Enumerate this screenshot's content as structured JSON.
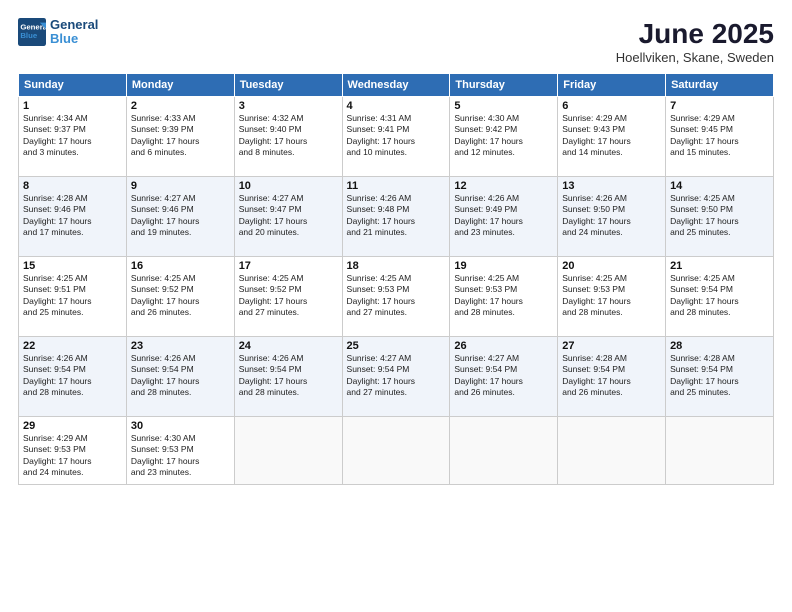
{
  "logo": {
    "line1": "General",
    "line2": "Blue"
  },
  "title": "June 2025",
  "subtitle": "Hoellviken, Skane, Sweden",
  "weekdays": [
    "Sunday",
    "Monday",
    "Tuesday",
    "Wednesday",
    "Thursday",
    "Friday",
    "Saturday"
  ],
  "weeks": [
    [
      {
        "day": 1,
        "sunrise": "4:34 AM",
        "sunset": "9:37 PM",
        "daylight": "17 hours and 3 minutes."
      },
      {
        "day": 2,
        "sunrise": "4:33 AM",
        "sunset": "9:39 PM",
        "daylight": "17 hours and 6 minutes."
      },
      {
        "day": 3,
        "sunrise": "4:32 AM",
        "sunset": "9:40 PM",
        "daylight": "17 hours and 8 minutes."
      },
      {
        "day": 4,
        "sunrise": "4:31 AM",
        "sunset": "9:41 PM",
        "daylight": "17 hours and 10 minutes."
      },
      {
        "day": 5,
        "sunrise": "4:30 AM",
        "sunset": "9:42 PM",
        "daylight": "17 hours and 12 minutes."
      },
      {
        "day": 6,
        "sunrise": "4:29 AM",
        "sunset": "9:43 PM",
        "daylight": "17 hours and 14 minutes."
      },
      {
        "day": 7,
        "sunrise": "4:29 AM",
        "sunset": "9:45 PM",
        "daylight": "17 hours and 15 minutes."
      }
    ],
    [
      {
        "day": 8,
        "sunrise": "4:28 AM",
        "sunset": "9:46 PM",
        "daylight": "17 hours and 17 minutes."
      },
      {
        "day": 9,
        "sunrise": "4:27 AM",
        "sunset": "9:46 PM",
        "daylight": "17 hours and 19 minutes."
      },
      {
        "day": 10,
        "sunrise": "4:27 AM",
        "sunset": "9:47 PM",
        "daylight": "17 hours and 20 minutes."
      },
      {
        "day": 11,
        "sunrise": "4:26 AM",
        "sunset": "9:48 PM",
        "daylight": "17 hours and 21 minutes."
      },
      {
        "day": 12,
        "sunrise": "4:26 AM",
        "sunset": "9:49 PM",
        "daylight": "17 hours and 23 minutes."
      },
      {
        "day": 13,
        "sunrise": "4:26 AM",
        "sunset": "9:50 PM",
        "daylight": "17 hours and 24 minutes."
      },
      {
        "day": 14,
        "sunrise": "4:25 AM",
        "sunset": "9:50 PM",
        "daylight": "17 hours and 25 minutes."
      }
    ],
    [
      {
        "day": 15,
        "sunrise": "4:25 AM",
        "sunset": "9:51 PM",
        "daylight": "17 hours and 25 minutes."
      },
      {
        "day": 16,
        "sunrise": "4:25 AM",
        "sunset": "9:52 PM",
        "daylight": "17 hours and 26 minutes."
      },
      {
        "day": 17,
        "sunrise": "4:25 AM",
        "sunset": "9:52 PM",
        "daylight": "17 hours and 27 minutes."
      },
      {
        "day": 18,
        "sunrise": "4:25 AM",
        "sunset": "9:53 PM",
        "daylight": "17 hours and 27 minutes."
      },
      {
        "day": 19,
        "sunrise": "4:25 AM",
        "sunset": "9:53 PM",
        "daylight": "17 hours and 28 minutes."
      },
      {
        "day": 20,
        "sunrise": "4:25 AM",
        "sunset": "9:53 PM",
        "daylight": "17 hours and 28 minutes."
      },
      {
        "day": 21,
        "sunrise": "4:25 AM",
        "sunset": "9:54 PM",
        "daylight": "17 hours and 28 minutes."
      }
    ],
    [
      {
        "day": 22,
        "sunrise": "4:26 AM",
        "sunset": "9:54 PM",
        "daylight": "17 hours and 28 minutes."
      },
      {
        "day": 23,
        "sunrise": "4:26 AM",
        "sunset": "9:54 PM",
        "daylight": "17 hours and 28 minutes."
      },
      {
        "day": 24,
        "sunrise": "4:26 AM",
        "sunset": "9:54 PM",
        "daylight": "17 hours and 28 minutes."
      },
      {
        "day": 25,
        "sunrise": "4:27 AM",
        "sunset": "9:54 PM",
        "daylight": "17 hours and 27 minutes."
      },
      {
        "day": 26,
        "sunrise": "4:27 AM",
        "sunset": "9:54 PM",
        "daylight": "17 hours and 26 minutes."
      },
      {
        "day": 27,
        "sunrise": "4:28 AM",
        "sunset": "9:54 PM",
        "daylight": "17 hours and 26 minutes."
      },
      {
        "day": 28,
        "sunrise": "4:28 AM",
        "sunset": "9:54 PM",
        "daylight": "17 hours and 25 minutes."
      }
    ],
    [
      {
        "day": 29,
        "sunrise": "4:29 AM",
        "sunset": "9:53 PM",
        "daylight": "17 hours and 24 minutes."
      },
      {
        "day": 30,
        "sunrise": "4:30 AM",
        "sunset": "9:53 PM",
        "daylight": "17 hours and 23 minutes."
      },
      null,
      null,
      null,
      null,
      null
    ]
  ],
  "labels": {
    "sunrise": "Sunrise:",
    "sunset": "Sunset:",
    "daylight": "Daylight:"
  }
}
